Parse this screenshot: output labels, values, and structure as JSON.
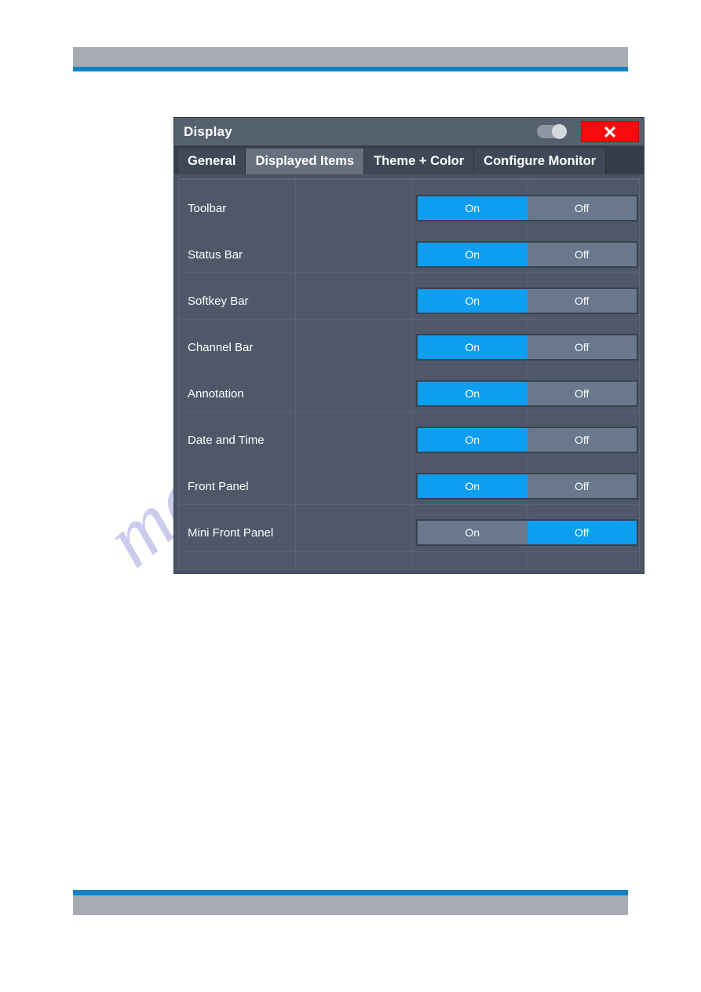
{
  "dialog": {
    "title": "Display",
    "titlebar_toggle": "header-toggle",
    "close_label": "close-icon",
    "tabs": [
      {
        "label": "General",
        "active": false
      },
      {
        "label": "Displayed Items",
        "active": true
      },
      {
        "label": "Theme + Color",
        "active": false
      },
      {
        "label": "Configure Monitor",
        "active": false
      }
    ],
    "segment_labels": {
      "on": "On",
      "off": "Off"
    },
    "rows": [
      {
        "label": "Toolbar",
        "value": "On"
      },
      {
        "label": "Status Bar",
        "value": "On"
      },
      {
        "label": "Softkey Bar",
        "value": "On"
      },
      {
        "label": "Channel Bar",
        "value": "On"
      },
      {
        "label": "Annotation",
        "value": "On"
      },
      {
        "label": "Date and Time",
        "value": "On"
      },
      {
        "label": "Front Panel",
        "value": "On"
      },
      {
        "label": "Mini Front Panel",
        "value": "Off"
      }
    ]
  },
  "page": {
    "watermark": "manualshive.com"
  },
  "colors": {
    "accent_blue": "#0d9ef0",
    "segment_gray": "#69788c",
    "close_red": "#f60c0c",
    "dialog_bg": "#4a5564",
    "titlebar_bg": "#56616f",
    "tabstrip_bg": "#343d4b",
    "tab_active_bg": "#67707d",
    "rule_blue": "#1083c6",
    "bar_gray": "#a6acb2"
  }
}
